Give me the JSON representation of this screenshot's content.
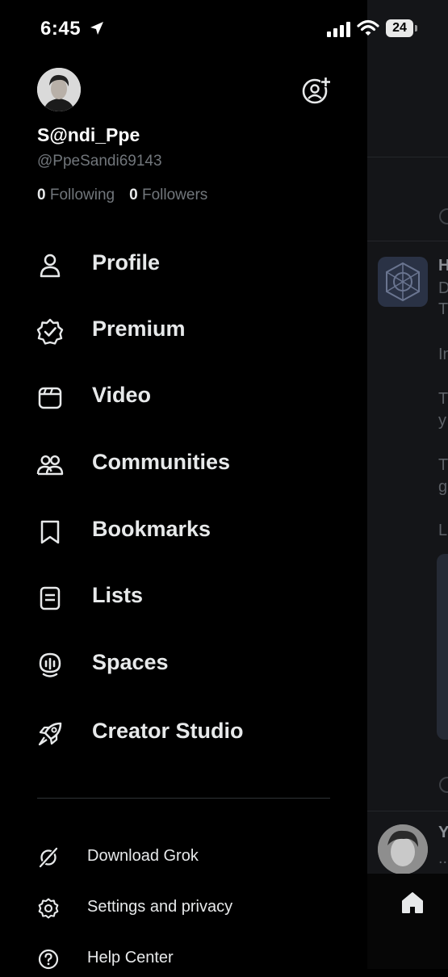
{
  "status_bar": {
    "time": "6:45",
    "battery": "24"
  },
  "profile": {
    "display_name": "S@ndi_Ppe",
    "handle": "@PpeSandi69143",
    "following_count": "0",
    "following_label": "Following",
    "followers_count": "0",
    "followers_label": "Followers"
  },
  "menu": {
    "profile": "Profile",
    "premium": "Premium",
    "video": "Video",
    "communities": "Communities",
    "bookmarks": "Bookmarks",
    "lists": "Lists",
    "spaces": "Spaces",
    "creator_studio": "Creator Studio"
  },
  "secondary_menu": {
    "download_grok": "Download Grok",
    "settings": "Settings and privacy",
    "help": "Help Center"
  },
  "background_timeline": {
    "letters": [
      "H",
      "D",
      "T",
      "In",
      "T",
      "y",
      "T",
      "g",
      "L",
      "Y",
      "..."
    ]
  },
  "icons": {
    "location": "location-arrow-icon",
    "add_account": "add-account-icon",
    "home": "home-icon"
  }
}
